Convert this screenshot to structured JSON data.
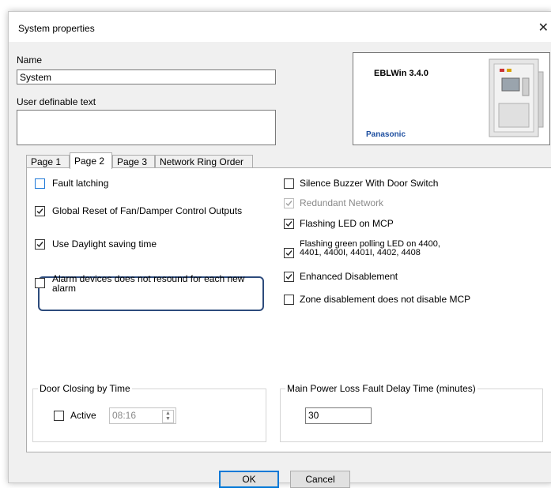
{
  "window": {
    "title": "System properties"
  },
  "fields": {
    "name_label": "Name",
    "name_value": "System",
    "user_text_label": "User definable text",
    "user_text_value": ""
  },
  "product": {
    "name": "EBLWin 3.4.0",
    "brand": "Panasonic",
    "brand_color": "#1e4fa0"
  },
  "tabs": [
    {
      "label": "Page 1",
      "active": false
    },
    {
      "label": "Page 2",
      "active": true
    },
    {
      "label": "Page 3",
      "active": false
    },
    {
      "label": "Network Ring Order",
      "active": false
    }
  ],
  "left_options": [
    {
      "label": "Fault latching",
      "checked": false,
      "focused": true
    },
    {
      "label": "Global Reset of Fan/Damper Control Outputs",
      "checked": true
    },
    {
      "label": "Use Daylight saving time",
      "checked": true
    },
    {
      "label": "Alarm devices does not resound for each new alarm",
      "checked": false,
      "highlighted": true
    }
  ],
  "right_options": [
    {
      "label": "Silence Buzzer With Door Switch",
      "checked": false,
      "enabled": true
    },
    {
      "label": "Redundant Network",
      "checked": true,
      "enabled": false
    },
    {
      "label": "Flashing LED on MCP",
      "checked": true,
      "enabled": true
    },
    {
      "label": "Flashing green polling LED on 4400, 4401, 4400I, 4401I, 4402, 4408",
      "checked": true,
      "enabled": true
    },
    {
      "label": "Enhanced Disablement",
      "checked": true,
      "enabled": true
    },
    {
      "label": "Zone disablement does not disable MCP",
      "checked": false,
      "enabled": true
    }
  ],
  "door_closing": {
    "title": "Door Closing by Time",
    "active_label": "Active",
    "active": false,
    "time": "08:16"
  },
  "power_loss": {
    "title": "Main Power Loss Fault Delay Time (minutes)",
    "value": "30"
  },
  "buttons": {
    "ok": "OK",
    "cancel": "Cancel"
  },
  "colors": {
    "accent": "#0078d7",
    "highlight_border": "#2d4b7c"
  }
}
